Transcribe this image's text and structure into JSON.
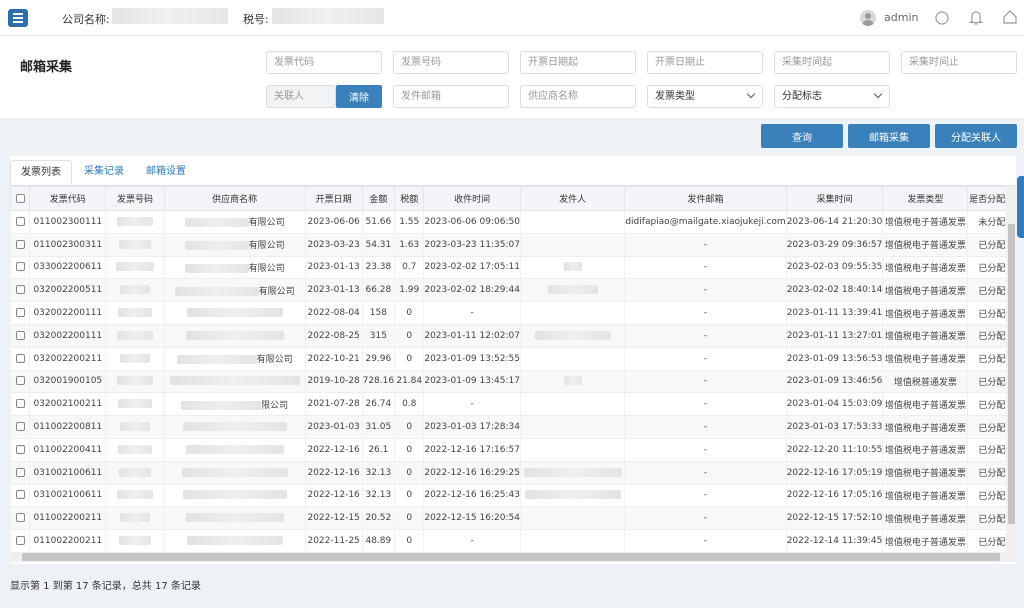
{
  "header": {
    "company_label": "公司名称:",
    "tax_label": "税号:",
    "user": "admin"
  },
  "page_title": "邮箱采集",
  "search": {
    "row1": [
      "发票代码",
      "发票号码",
      "开票日期起",
      "开票日期止",
      "采集时间起",
      "采集时间止"
    ],
    "contact_placeholder": "关联人",
    "clear_label": "清除",
    "sender_email_placeholder": "发件邮箱",
    "supplier_placeholder": "供应商名称",
    "invoice_type_select": "发票类型",
    "assign_flag_select": "分配标志"
  },
  "actions": {
    "query": "查询",
    "email_collect": "邮箱采集",
    "assign_contact": "分配关联人"
  },
  "tabs": [
    "发票列表",
    "采集记录",
    "邮箱设置"
  ],
  "columns": [
    "",
    "发票代码",
    "发票号码",
    "供应商名称",
    "开票日期",
    "金额",
    "税额",
    "收件时间",
    "发件人",
    "发件邮箱",
    "采集时间",
    "发票类型",
    "是否分配关"
  ],
  "rows": [
    {
      "code": "011002300111",
      "supplier_suffix": "有限公司",
      "date": "2023-06-06",
      "amount": "51.66",
      "tax": "1.55",
      "recv": "2023-06-06 09:06:50",
      "email": "didifapiao@mailgate.xiaojukeji.com",
      "collect": "2023-06-14 21:20:30",
      "type": "增值税电子普通发票",
      "assigned": "未分配"
    },
    {
      "code": "011002300311",
      "supplier_suffix": "有限公司",
      "date": "2023-03-23",
      "amount": "54.31",
      "tax": "1.63",
      "recv": "2023-03-23 11:35:07",
      "email": "-",
      "collect": "2023-03-29 09:36:57",
      "type": "增值税电子普通发票",
      "assigned": "已分配"
    },
    {
      "code": "033002200611",
      "supplier_suffix": "有限公司",
      "date": "2023-01-13",
      "amount": "23.38",
      "tax": "0.7",
      "recv": "2023-02-02 17:05:11",
      "email": "-",
      "collect": "2023-02-03 09:55:35",
      "type": "增值税电子普通发票",
      "assigned": "已分配"
    },
    {
      "code": "032002200511",
      "supplier_suffix": "有限公司",
      "date": "2023-01-13",
      "amount": "66.28",
      "tax": "1.99",
      "recv": "2023-02-02 18:29:44",
      "email": "-",
      "collect": "2023-02-02 18:40:14",
      "type": "增值税电子普通发票",
      "assigned": "已分配"
    },
    {
      "code": "032002200111",
      "supplier_suffix": "",
      "date": "2022-08-04",
      "amount": "158",
      "tax": "0",
      "recv": "-",
      "email": "-",
      "collect": "2023-01-11 13:39:41",
      "type": "增值税电子普通发票",
      "assigned": "已分配"
    },
    {
      "code": "032002200111",
      "supplier_suffix": "",
      "date": "2022-08-25",
      "amount": "315",
      "tax": "0",
      "recv": "2023-01-11 12:02:07",
      "email": "-",
      "collect": "2023-01-11 13:27:01",
      "type": "增值税电子普通发票",
      "assigned": "已分配"
    },
    {
      "code": "032002200211",
      "supplier_suffix": "有限公司",
      "date": "2022-10-21",
      "amount": "29.96",
      "tax": "0",
      "recv": "2023-01-09 13:52:55",
      "email": "-",
      "collect": "2023-01-09 13:56:53",
      "type": "增值税电子普通发票",
      "assigned": "已分配"
    },
    {
      "code": "032001900105",
      "supplier_suffix": "",
      "date": "2019-10-28",
      "amount": "728.16",
      "tax": "21.84",
      "recv": "2023-01-09 13:45:17",
      "email": "-",
      "collect": "2023-01-09 13:46:56",
      "type": "增值税普通发票",
      "assigned": "已分配"
    },
    {
      "code": "032002100211",
      "supplier_suffix": "限公司",
      "date": "2021-07-28",
      "amount": "26.74",
      "tax": "0.8",
      "recv": "-",
      "email": "-",
      "collect": "2023-01-04 15:03:09",
      "type": "增值税电子普通发票",
      "assigned": "已分配"
    },
    {
      "code": "011002200811",
      "supplier_suffix": "",
      "date": "2023-01-03",
      "amount": "31.05",
      "tax": "0",
      "recv": "2023-01-03 17:28:34",
      "email": "-",
      "collect": "2023-01-03 17:53:33",
      "type": "增值税电子普通发票",
      "assigned": "已分配"
    },
    {
      "code": "011002200411",
      "supplier_suffix": "",
      "date": "2022-12-16",
      "amount": "26.1",
      "tax": "0",
      "recv": "2022-12-16 17:16:57",
      "email": "-",
      "collect": "2022-12-20 11:10:55",
      "type": "增值税电子普通发票",
      "assigned": "已分配"
    },
    {
      "code": "031002100611",
      "supplier_suffix": "",
      "date": "2022-12-16",
      "amount": "32.13",
      "tax": "0",
      "recv": "2022-12-16 16:29:25",
      "email": "-",
      "collect": "2022-12-16 17:05:19",
      "type": "增值税电子普通发票",
      "assigned": "已分配"
    },
    {
      "code": "031002100611",
      "supplier_suffix": "",
      "date": "2022-12-16",
      "amount": "32.13",
      "tax": "0",
      "recv": "2022-12-16 16:25:43",
      "email": "-",
      "collect": "2022-12-16 17:05:16",
      "type": "增值税电子普通发票",
      "assigned": "已分配"
    },
    {
      "code": "011002200211",
      "supplier_suffix": "",
      "date": "2022-12-15",
      "amount": "20.52",
      "tax": "0",
      "recv": "2022-12-15 16:20:54",
      "email": "-",
      "collect": "2022-12-15 17:52:10",
      "type": "增值税电子普通发票",
      "assigned": "已分配"
    },
    {
      "code": "011002200211",
      "supplier_suffix": "",
      "date": "2022-11-25",
      "amount": "48.89",
      "tax": "0",
      "recv": "-",
      "email": "-",
      "collect": "2022-12-14 11:39:45",
      "type": "增值税电子普通发票",
      "assigned": "已分配"
    }
  ],
  "footer_text": "显示第 1 到第 17 条记录，总共 17 条记录",
  "colors": {
    "primary": "#3a80bb",
    "link": "#2f7bc0",
    "header_bg": "#f3f5f8"
  }
}
